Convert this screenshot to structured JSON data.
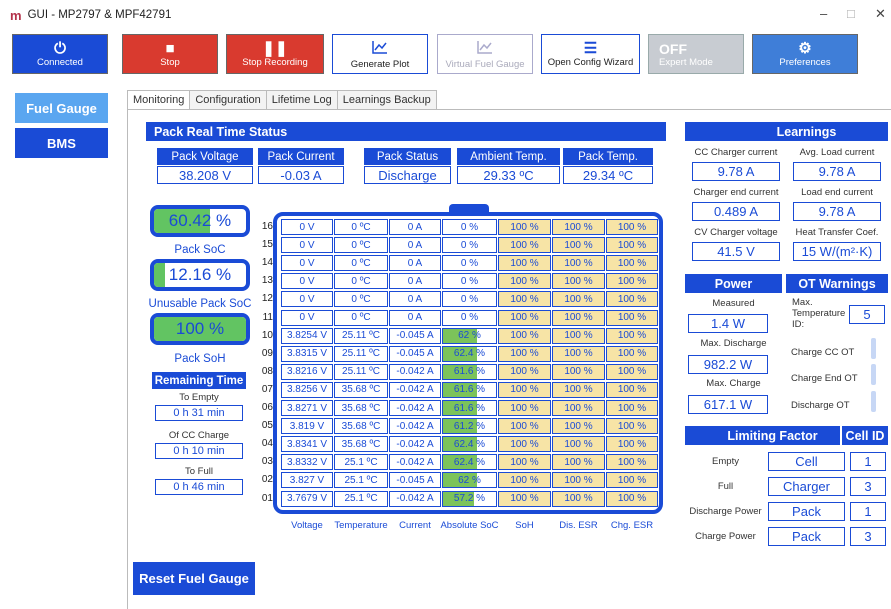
{
  "window": {
    "logo": "m",
    "title": "GUI - MP2797 & MPF42791",
    "minimize": "–",
    "maximize": "□",
    "close": "✕"
  },
  "toolbar": {
    "connected": {
      "icon": "⏻",
      "label": "Connected"
    },
    "stop": {
      "icon": "■",
      "label": "Stop"
    },
    "stop_recording": {
      "icon": "❚❚",
      "label": "Stop Recording"
    },
    "generate_plot": {
      "icon": "📈",
      "label": "Generate Plot"
    },
    "virtual_fuel_gauge": {
      "icon": "📈",
      "label": "Virtual Fuel Gauge"
    },
    "open_config_wizard": {
      "icon": "☰",
      "label": "Open Config Wizard"
    },
    "expert_mode": {
      "state": "OFF",
      "label": "Expert Mode"
    },
    "preferences": {
      "icon": "⚙",
      "label": "Preferences"
    }
  },
  "sidebar": {
    "items": [
      "Fuel Gauge",
      "BMS"
    ]
  },
  "tabs": [
    "Monitoring",
    "Configuration",
    "Lifetime Log",
    "Learnings Backup"
  ],
  "pack_status": {
    "header": "Pack Real Time Status",
    "fields": [
      {
        "label": "Pack Voltage",
        "value": "38.208 V"
      },
      {
        "label": "Pack Current",
        "value": "-0.03 A"
      },
      {
        "label": "Pack Status",
        "value": "Discharge"
      },
      {
        "label": "Ambient Temp.",
        "value": "29.33 ºC"
      },
      {
        "label": "Pack Temp.",
        "value": "29.34 ºC"
      }
    ]
  },
  "gauges": {
    "soc": {
      "value": "60.42 %",
      "label": "Pack SoC",
      "fraction": 0.6042
    },
    "unusable": {
      "value": "12.16 %",
      "label": "Unusable Pack SoC",
      "fraction": 0.1216
    },
    "soh": {
      "value": "100 %",
      "label": "Pack SoH",
      "fraction": 1.0
    }
  },
  "remaining": {
    "header": "Remaining Time",
    "to_empty_label": "To Empty",
    "to_empty": "0 h 31 min",
    "of_cc_label": "Of CC Charge",
    "of_cc": "0 h 10 min",
    "to_full_label": "To Full",
    "to_full": "0 h 46 min"
  },
  "cells": {
    "columns": [
      "Voltage",
      "Temperature",
      "Current",
      "Absolute SoC",
      "SoH",
      "Dis. ESR",
      "Chg. ESR"
    ],
    "rows": [
      {
        "id": "16",
        "v": [
          "0 V",
          "0 ºC",
          "0 A",
          "0 %",
          "100 %",
          "100 %",
          "100 %"
        ],
        "soc": 0
      },
      {
        "id": "15",
        "v": [
          "0 V",
          "0 ºC",
          "0 A",
          "0 %",
          "100 %",
          "100 %",
          "100 %"
        ],
        "soc": 0
      },
      {
        "id": "14",
        "v": [
          "0 V",
          "0 ºC",
          "0 A",
          "0 %",
          "100 %",
          "100 %",
          "100 %"
        ],
        "soc": 0
      },
      {
        "id": "13",
        "v": [
          "0 V",
          "0 ºC",
          "0 A",
          "0 %",
          "100 %",
          "100 %",
          "100 %"
        ],
        "soc": 0
      },
      {
        "id": "12",
        "v": [
          "0 V",
          "0 ºC",
          "0 A",
          "0 %",
          "100 %",
          "100 %",
          "100 %"
        ],
        "soc": 0
      },
      {
        "id": "11",
        "v": [
          "0 V",
          "0 ºC",
          "0 A",
          "0 %",
          "100 %",
          "100 %",
          "100 %"
        ],
        "soc": 0
      },
      {
        "id": "10",
        "v": [
          "3.8254 V",
          "25.11 ºC",
          "-0.045 A",
          "62 %",
          "100 %",
          "100 %",
          "100 %"
        ],
        "soc": 62
      },
      {
        "id": "09",
        "v": [
          "3.8315 V",
          "25.11 ºC",
          "-0.045 A",
          "62.4 %",
          "100 %",
          "100 %",
          "100 %"
        ],
        "soc": 62.4
      },
      {
        "id": "08",
        "v": [
          "3.8216 V",
          "25.11 ºC",
          "-0.042 A",
          "61.6 %",
          "100 %",
          "100 %",
          "100 %"
        ],
        "soc": 61.6
      },
      {
        "id": "07",
        "v": [
          "3.8256 V",
          "35.68 ºC",
          "-0.042 A",
          "61.6 %",
          "100 %",
          "100 %",
          "100 %"
        ],
        "soc": 61.6
      },
      {
        "id": "06",
        "v": [
          "3.8271 V",
          "35.68 ºC",
          "-0.042 A",
          "61.6 %",
          "100 %",
          "100 %",
          "100 %"
        ],
        "soc": 61.6
      },
      {
        "id": "05",
        "v": [
          "3.819 V",
          "35.68 ºC",
          "-0.042 A",
          "61.2 %",
          "100 %",
          "100 %",
          "100 %"
        ],
        "soc": 61.2
      },
      {
        "id": "04",
        "v": [
          "3.8341 V",
          "35.68 ºC",
          "-0.042 A",
          "62.4 %",
          "100 %",
          "100 %",
          "100 %"
        ],
        "soc": 62.4
      },
      {
        "id": "03",
        "v": [
          "3.8332 V",
          "25.1 ºC",
          "-0.042 A",
          "62.4 %",
          "100 %",
          "100 %",
          "100 %"
        ],
        "soc": 62.4
      },
      {
        "id": "02",
        "v": [
          "3.827 V",
          "25.1 ºC",
          "-0.045 A",
          "62 %",
          "100 %",
          "100 %",
          "100 %"
        ],
        "soc": 62
      },
      {
        "id": "01",
        "v": [
          "3.7679 V",
          "25.1 ºC",
          "-0.042 A",
          "57.2 %",
          "100 %",
          "100 %",
          "100 %"
        ],
        "soc": 57.2
      }
    ]
  },
  "learnings": {
    "header": "Learnings",
    "items": [
      {
        "label": "CC Charger current",
        "value": "9.78 A"
      },
      {
        "label": "Avg. Load current",
        "value": "9.78 A"
      },
      {
        "label": "Charger end current",
        "value": "0.489 A"
      },
      {
        "label": "Load end current",
        "value": "9.78 A"
      },
      {
        "label": "CV Charger voltage",
        "value": "41.5 V"
      },
      {
        "label": "Heat Transfer Coef.",
        "value": "15 W/(m²·K)"
      }
    ]
  },
  "power": {
    "header": "Power",
    "measured_label": "Measured",
    "measured": "1.4 W",
    "max_discharge_label": "Max. Discharge",
    "max_discharge": "982.2 W",
    "max_charge_label": "Max. Charge",
    "max_charge": "617.1 W"
  },
  "ot_warnings": {
    "header": "OT Warnings",
    "max_temp_label": "Max. Temperature ID:",
    "max_temp_id": "5",
    "charge_cc_label": "Charge CC OT",
    "charge_end_label": "Charge End OT",
    "discharge_label": "Discharge OT"
  },
  "limiting": {
    "header": "Limiting Factor",
    "cell_id_header": "Cell ID",
    "rows": [
      {
        "label": "Empty",
        "factor": "Cell",
        "id": "1"
      },
      {
        "label": "Full",
        "factor": "Charger",
        "id": "3"
      },
      {
        "label": "Discharge Power",
        "factor": "Pack",
        "id": "1"
      },
      {
        "label": "Charge Power",
        "factor": "Pack",
        "id": "3"
      }
    ]
  },
  "reset_button": "Reset Fuel Gauge"
}
